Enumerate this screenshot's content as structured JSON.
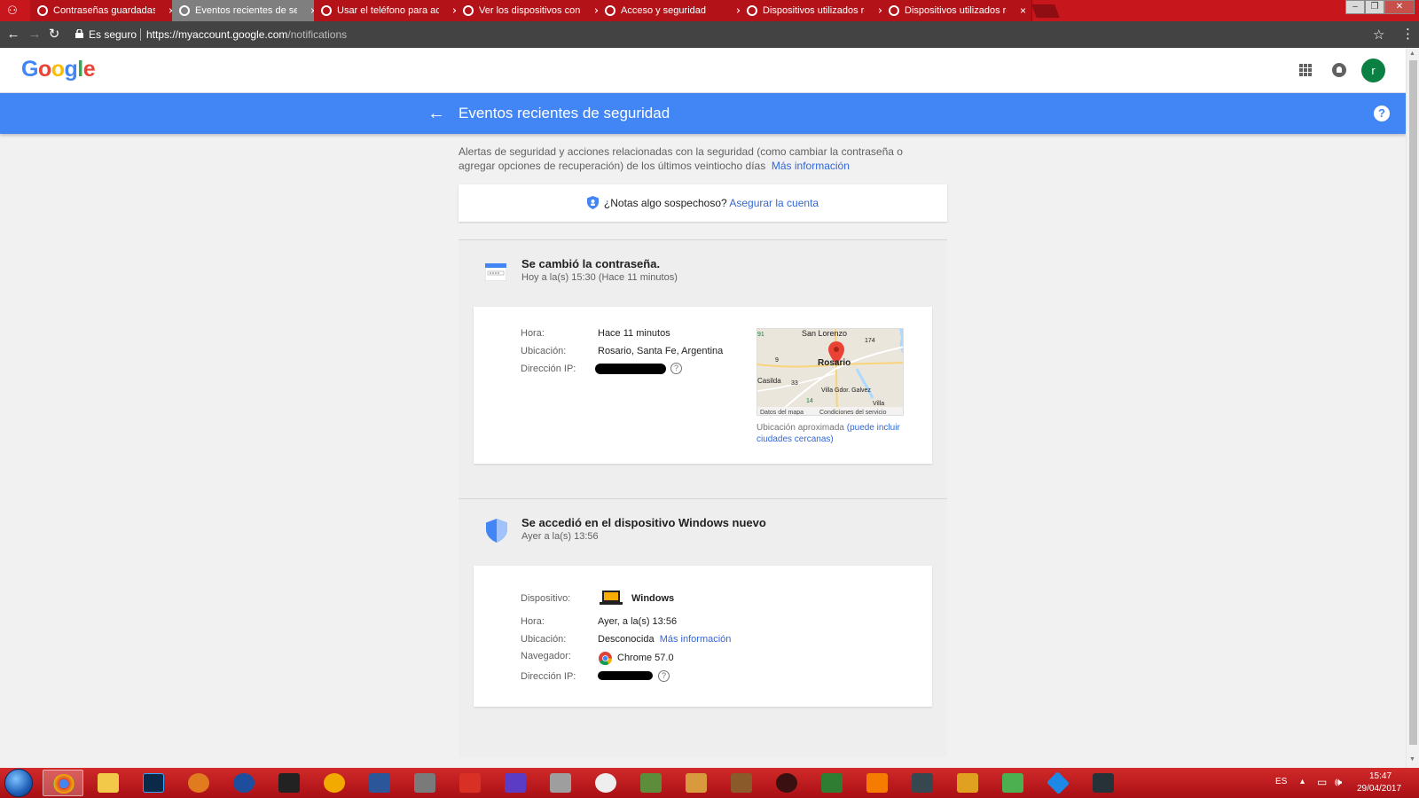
{
  "browser": {
    "tabs": [
      {
        "title": "Contraseñas guardadas",
        "close": "×"
      },
      {
        "title": "Eventos recientes de seg",
        "close": "×",
        "active": true
      },
      {
        "title": "Usar el teléfono para acc",
        "close": "×"
      },
      {
        "title": "Ver los dispositivos con",
        "close": "×"
      },
      {
        "title": "Acceso y seguridad",
        "close": "×"
      },
      {
        "title": "Dispositivos utilizados re",
        "close": "×"
      },
      {
        "title": "Dispositivos utilizados re",
        "close": "×"
      }
    ],
    "secure_label": "Es seguro",
    "url_host": "https://myaccount.google.com",
    "url_path": "/notifications"
  },
  "app": {
    "logo": {
      "G": "G",
      "o1": "o",
      "o2": "o",
      "g": "g",
      "l": "l",
      "e": "e"
    },
    "avatar_letter": "r",
    "page_title": "Eventos recientes de seguridad",
    "help": "?"
  },
  "intro": {
    "text": "Alertas de seguridad y acciones relacionadas con la seguridad (como cambiar la contraseña o agregar opciones de recuperación) de los últimos veintiocho días",
    "link": "Más información"
  },
  "suspicious": {
    "question": "¿Notas algo sospechoso?",
    "link": "Asegurar la cuenta"
  },
  "events": [
    {
      "title": "Se cambió la contraseña.",
      "subtitle": "Hoy a la(s) 15:30 (Hace 11 minutos)",
      "labels": {
        "time": "Hora:",
        "location": "Ubicación:",
        "ip": "Dirección IP:"
      },
      "values": {
        "time": "Hace 11 minutos",
        "location": "Rosario, Santa Fe, Argentina"
      },
      "map": {
        "labels": [
          "San Lorenzo",
          "Rosario",
          "Casilda",
          "Villa Gdor. Galvez",
          "Villa",
          "174",
          "9",
          "33",
          "14",
          "91"
        ],
        "footer_left": "Datos del mapa",
        "footer_right": "Condiciones del servicio"
      },
      "map_caption": "Ubicación aproximada",
      "map_caption_link": "(puede incluir ciudades cercanas)"
    },
    {
      "title": "Se accedió en el dispositivo Windows nuevo",
      "subtitle": "Ayer a la(s) 13:56",
      "labels": {
        "device": "Dispositivo:",
        "time": "Hora:",
        "location": "Ubicación:",
        "browser": "Navegador:",
        "ip": "Dirección IP:"
      },
      "values": {
        "device": "Windows",
        "time": "Ayer, a la(s) 13:56",
        "location": "Desconocida",
        "location_link": "Más información",
        "browser": "Chrome 57.0"
      }
    }
  ],
  "taskbar": {
    "lang": "ES",
    "time": "15:47",
    "date": "29/04/2017"
  },
  "colors": {
    "accent": "#4285f4",
    "link": "#3367d6",
    "chrome_frame": "#c8161d"
  }
}
